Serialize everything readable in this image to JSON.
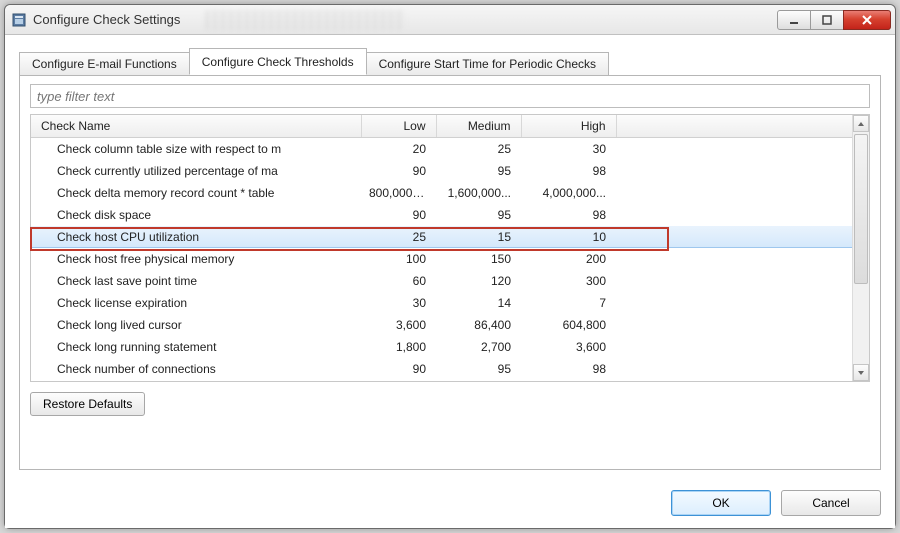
{
  "window": {
    "title": "Configure Check Settings"
  },
  "tabs": [
    {
      "label": "Configure E-mail Functions",
      "active": false
    },
    {
      "label": "Configure Check Thresholds",
      "active": true
    },
    {
      "label": "Configure Start Time for Periodic Checks",
      "active": false
    }
  ],
  "filter": {
    "placeholder": "type filter text",
    "value": ""
  },
  "columns": {
    "name": "Check Name",
    "low": "Low",
    "medium": "Medium",
    "high": "High"
  },
  "rows": [
    {
      "name": "Check column table size with respect to m",
      "low": "20",
      "medium": "25",
      "high": "30",
      "selected": false
    },
    {
      "name": "Check currently utilized percentage of ma",
      "low": "90",
      "medium": "95",
      "high": "98",
      "selected": false
    },
    {
      "name": "Check delta memory record count * table",
      "low": "800,000,0...",
      "medium": "1,600,000...",
      "high": "4,000,000...",
      "selected": false
    },
    {
      "name": "Check disk space",
      "low": "90",
      "medium": "95",
      "high": "98",
      "selected": false
    },
    {
      "name": "Check host CPU utilization",
      "low": "25",
      "medium": "15",
      "high": "10",
      "selected": true
    },
    {
      "name": "Check host free physical memory",
      "low": "100",
      "medium": "150",
      "high": "200",
      "selected": false
    },
    {
      "name": "Check last save point time",
      "low": "60",
      "medium": "120",
      "high": "300",
      "selected": false
    },
    {
      "name": "Check license expiration",
      "low": "30",
      "medium": "14",
      "high": "7",
      "selected": false
    },
    {
      "name": "Check long lived cursor",
      "low": "3,600",
      "medium": "86,400",
      "high": "604,800",
      "selected": false
    },
    {
      "name": "Check long running statement",
      "low": "1,800",
      "medium": "2,700",
      "high": "3,600",
      "selected": false
    },
    {
      "name": "Check number of connections",
      "low": "90",
      "medium": "95",
      "high": "98",
      "selected": false
    }
  ],
  "buttons": {
    "restore": "Restore Defaults",
    "ok": "OK",
    "cancel": "Cancel"
  }
}
